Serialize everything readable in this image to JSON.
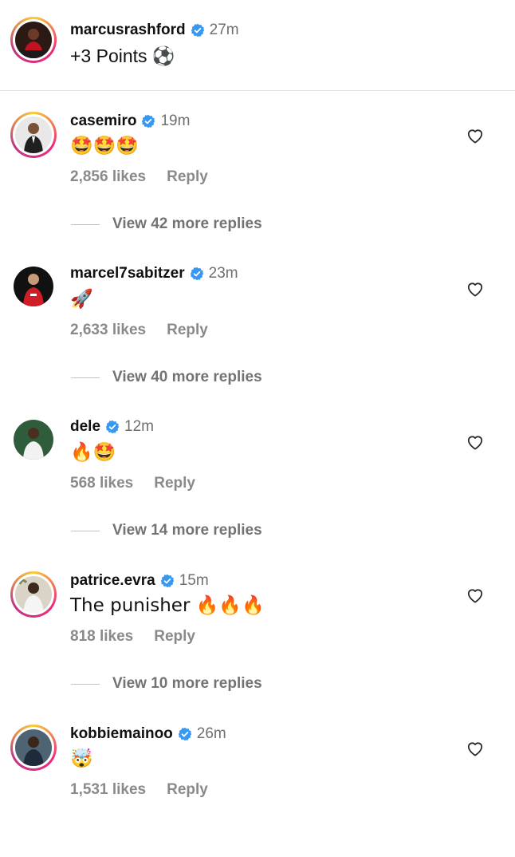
{
  "post": {
    "username": "marcusrashford",
    "time": "27m",
    "caption": "+3 Points ⚽"
  },
  "comments": [
    {
      "username": "casemiro",
      "time": "19m",
      "text": "🤩🤩🤩",
      "likes": "2,856 likes",
      "reply_label": "Reply",
      "view_replies": "View 42 more replies"
    },
    {
      "username": "marcel7sabitzer",
      "time": "23m",
      "text": "🚀",
      "likes": "2,633 likes",
      "reply_label": "Reply",
      "view_replies": "View 40 more replies"
    },
    {
      "username": "dele",
      "time": "12m",
      "text": "🔥🤩",
      "likes": "568 likes",
      "reply_label": "Reply",
      "view_replies": "View 14 more replies"
    },
    {
      "username": "patrice.evra",
      "time": "15m",
      "text": "The punisher 🔥🔥🔥",
      "likes": "818 likes",
      "reply_label": "Reply",
      "view_replies": "View 10 more replies"
    },
    {
      "username": "kobbiemainoo",
      "time": "26m",
      "text": "🤯",
      "likes": "1,531 likes",
      "reply_label": "Reply"
    }
  ],
  "icons": {
    "verified": "verified-badge-icon",
    "like": "heart-icon"
  },
  "colors": {
    "verified_blue": "#3897f0",
    "story_ring": "#ee2a7b",
    "muted_text": "#8a8a8a"
  }
}
